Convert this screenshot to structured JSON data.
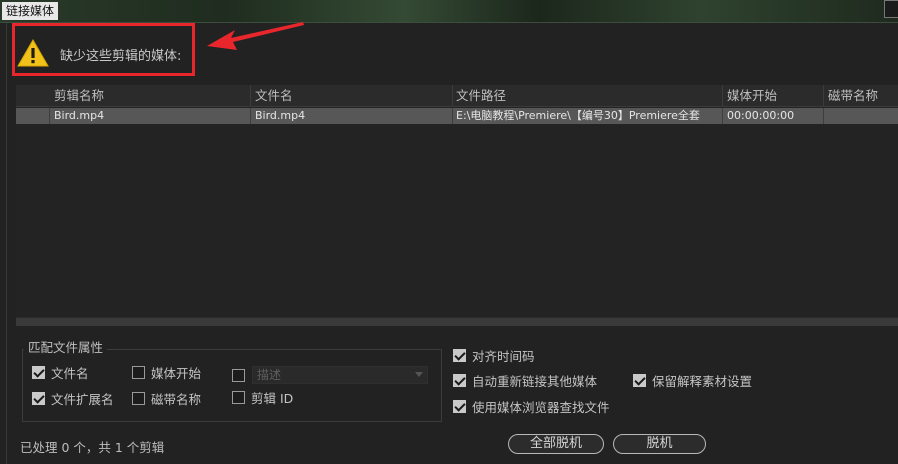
{
  "window": {
    "title": "链接媒体"
  },
  "warning": {
    "message": "缺少这些剪辑的媒体:"
  },
  "table": {
    "columns": [
      "剪辑名称",
      "文件名",
      "文件路径",
      "媒体开始",
      "磁带名称"
    ],
    "rows": [
      {
        "clip_name": "Bird.mp4",
        "file_name": "Bird.mp4",
        "file_path": "E:\\电脑教程\\Premiere\\【编号30】Premiere全套",
        "media_start": "00:00:00:00",
        "tape_name": ""
      }
    ]
  },
  "match_group": {
    "title": "匹配文件属性",
    "file_name": {
      "label": "文件名",
      "checked": true
    },
    "file_extension": {
      "label": "文件扩展名",
      "checked": true
    },
    "media_start": {
      "label": "媒体开始",
      "checked": false
    },
    "tape_name": {
      "label": "磁带名称",
      "checked": false
    },
    "description": {
      "label": "描述",
      "checked": false
    },
    "clip_id": {
      "label": "剪辑 ID",
      "checked": false
    }
  },
  "options": {
    "align_timecode": {
      "label": "对齐时间码",
      "checked": true
    },
    "auto_relink": {
      "label": "自动重新链接其他媒体",
      "checked": true
    },
    "preserve_interpret": {
      "label": "保留解释素材设置",
      "checked": true
    },
    "use_media_browser": {
      "label": "使用媒体浏览器查找文件",
      "checked": true
    }
  },
  "status": {
    "text": "已处理 0 个，共 1 个剪辑"
  },
  "buttons": {
    "offline_all": "全部脱机",
    "offline": "脱机"
  },
  "colors": {
    "annotation_red": "#e8262c",
    "warning_yellow": "#f2c21b",
    "selected_row": "#575757"
  }
}
